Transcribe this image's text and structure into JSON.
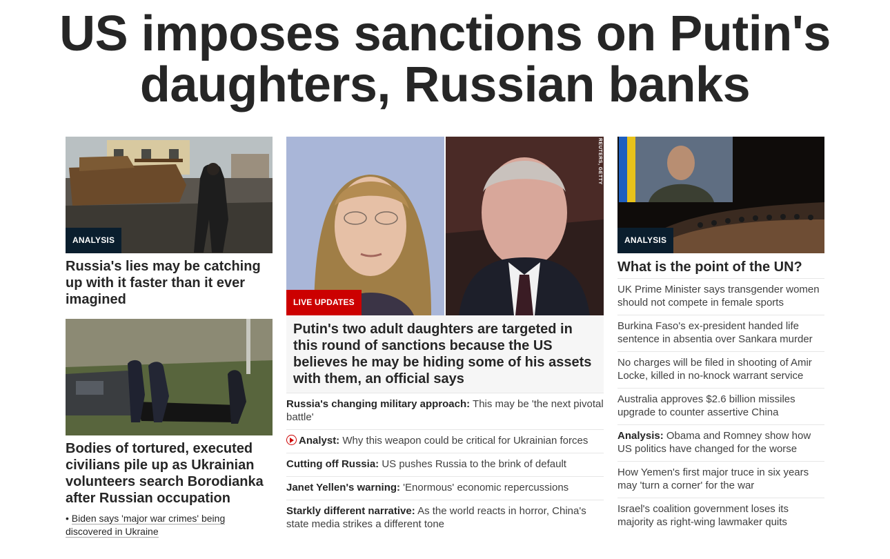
{
  "headline": "US imposes sanctions on Putin's daughters, Russian banks",
  "left": {
    "card1": {
      "badge": "ANALYSIS",
      "title": "Russia's lies may be catching up with it faster than it ever imagined"
    },
    "card2": {
      "title": "Bodies of tortured, executed civilians pile up as Ukrainian volunteers search Borodianka after Russian occupation",
      "bullet": "•",
      "link": "Biden says 'major war crimes' being discovered in Ukraine"
    }
  },
  "middle": {
    "badge": "LIVE UPDATES",
    "credit": "REUTERS, GETTY",
    "title": "Putin's two adult daughters are targeted in this round of sanctions because the US believes he may be hiding some of his assets with them, an official says",
    "items": [
      {
        "lead": "Russia's changing military approach:",
        "text": " This may be 'the next pivotal battle'"
      },
      {
        "lead": "Analyst:",
        "text": " Why this weapon could be critical for Ukrainian forces"
      },
      {
        "lead": "Cutting off Russia:",
        "text": " US pushes Russia to the brink of default"
      },
      {
        "lead": "Janet Yellen's warning:",
        "text": " 'Enormous' economic repercussions"
      },
      {
        "lead": "Starkly different narrative:",
        "text": " As the world reacts in horror, China's state media strikes a different tone"
      }
    ]
  },
  "right": {
    "badge": "ANALYSIS",
    "title": "What is the point of the UN?",
    "items": [
      {
        "lead": "",
        "text": "UK Prime Minister says transgender women should not compete in female sports"
      },
      {
        "lead": "",
        "text": "Burkina Faso's ex-president handed life sentence in absentia over Sankara murder"
      },
      {
        "lead": "",
        "text": "No charges will be filed in shooting of Amir Locke, killed in no-knock warrant service"
      },
      {
        "lead": "",
        "text": "Australia approves $2.6 billion missiles upgrade to counter assertive China"
      },
      {
        "lead": "Analysis:",
        "text": " Obama and Romney show how US politics have changed for the worse"
      },
      {
        "lead": "",
        "text": "How Yemen's first major truce in six years may 'turn a corner' for the war"
      },
      {
        "lead": "",
        "text": "Israel's coalition government loses its majority as right-wing lawmaker quits"
      }
    ]
  },
  "colors": {
    "live": "#cc0000",
    "analysis": "#0a1e2e"
  }
}
